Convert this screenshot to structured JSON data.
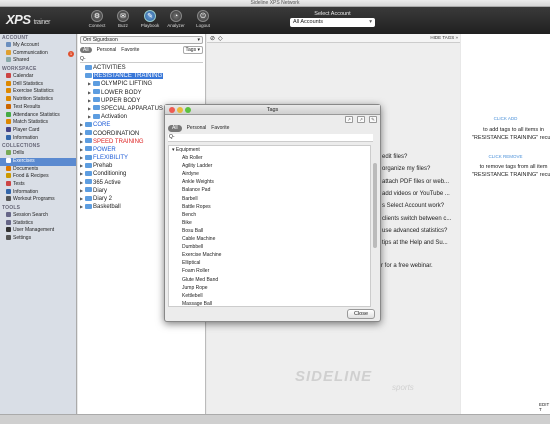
{
  "window": {
    "title": "Sideline XPS Network"
  },
  "toolbar": {
    "logo": "XPS",
    "logo_suffix": "trainer",
    "buttons": [
      {
        "label": "Connect",
        "icon": "connect-icon",
        "glyph": "⚙"
      },
      {
        "label": "Buzz",
        "icon": "buzz-icon",
        "glyph": "✉"
      },
      {
        "label": "Playbook",
        "icon": "playbook-icon",
        "glyph": "✎"
      },
      {
        "label": "Analyzer",
        "icon": "analyzer-icon",
        "glyph": "◔"
      },
      {
        "label": "Logout",
        "icon": "logout-icon",
        "glyph": "⏻"
      }
    ],
    "account_label": "Select Account",
    "account_value": "All Accounts"
  },
  "sidebar": {
    "sections": [
      {
        "title": "ACCOUNT",
        "items": [
          {
            "label": "My Account",
            "color": "#6b8fbf"
          },
          {
            "label": "Communication",
            "color": "#e0a030",
            "badge": "1"
          },
          {
            "label": "Shared",
            "color": "#8aa"
          }
        ]
      },
      {
        "title": "WORKSPACE",
        "items": [
          {
            "label": "Calendar",
            "color": "#c44"
          },
          {
            "label": "Drill Statistics",
            "color": "#d80"
          },
          {
            "label": "Exercise Statistics",
            "color": "#d80"
          },
          {
            "label": "Nutrition Statistics",
            "color": "#d80"
          },
          {
            "label": "Test Results",
            "color": "#c60"
          },
          {
            "label": "Attendance Statistics",
            "color": "#4a4"
          },
          {
            "label": "Match Statistics",
            "color": "#d80"
          },
          {
            "label": "Player Card",
            "color": "#448"
          },
          {
            "label": "Information",
            "color": "#36a"
          }
        ]
      },
      {
        "title": "COLLECTIONS",
        "items": [
          {
            "label": "Drills",
            "color": "#7a5"
          },
          {
            "label": "Exercises",
            "color": "#fff",
            "selected": true
          },
          {
            "label": "Documents",
            "color": "#d70"
          },
          {
            "label": "Food & Recipes",
            "color": "#c90"
          },
          {
            "label": "Tests",
            "color": "#c44"
          },
          {
            "label": "Information",
            "color": "#36a"
          },
          {
            "label": "Workout Programs",
            "color": "#555"
          }
        ]
      },
      {
        "title": "TOOLS",
        "items": [
          {
            "label": "Session Search",
            "color": "#668"
          },
          {
            "label": "Statistics",
            "color": "#668"
          },
          {
            "label": "User Management",
            "color": "#333"
          },
          {
            "label": "Settings",
            "color": "#555"
          }
        ]
      }
    ]
  },
  "middle": {
    "dropdown": "Orri Sigurdsson",
    "tabs": {
      "all": "All",
      "personal": "Personal",
      "favorite": "Favorite",
      "tags": "Tags"
    },
    "search_placeholder": "Q-",
    "tree": [
      {
        "label": "ACTIVITIES",
        "level": 0,
        "arrow": false
      },
      {
        "label": "RESISTANCE TRAINING",
        "level": 0,
        "arrow": false,
        "style": "hl"
      },
      {
        "label": "OLYMPIC LIFTING",
        "level": 1,
        "arrow": true
      },
      {
        "label": "LOWER BODY",
        "level": 1,
        "arrow": true
      },
      {
        "label": "UPPER BODY",
        "level": 1,
        "arrow": true
      },
      {
        "label": "SPECIAL APPARATUS",
        "level": 1,
        "arrow": true
      },
      {
        "label": "Activation",
        "level": 1,
        "arrow": true
      },
      {
        "label": "CORE",
        "level": 0,
        "arrow": true,
        "style": "blue"
      },
      {
        "label": "COORDINATION",
        "level": 0,
        "arrow": true
      },
      {
        "label": "SPEED TRAINING",
        "level": 0,
        "arrow": true,
        "style": "red"
      },
      {
        "label": "POWER",
        "level": 0,
        "arrow": true,
        "style": "blue"
      },
      {
        "label": "FLEXIBILITY",
        "level": 0,
        "arrow": true,
        "style": "blue"
      },
      {
        "label": "Prehab",
        "level": 0,
        "arrow": true
      },
      {
        "label": "Conditioning",
        "level": 0,
        "arrow": true
      },
      {
        "label": "365 Active",
        "level": 0,
        "arrow": true
      },
      {
        "label": "Diary",
        "level": 0,
        "arrow": true
      },
      {
        "label": "Diary 2",
        "level": 0,
        "arrow": true
      },
      {
        "label": "Basketball",
        "level": 0,
        "arrow": true
      }
    ]
  },
  "main": {
    "hide_tags": "HIDE TAGS »",
    "help_lines": [
      "edit files?",
      "organize my files?",
      "attach PDF files or web...",
      "add videos or YouTube ...",
      "s Select Account work?",
      "clients switch between c...",
      "use advanced statistics?",
      "tips at the Help and Su..."
    ],
    "webinar_text": "r for a free webinar.",
    "watermark": "SIDELINE",
    "watermark2": "sports"
  },
  "right": {
    "click_add": "CLICK ADD",
    "add_line1": "to add tags to all items in",
    "add_line2": "\"RESISTANCE TRAINING\" recurs",
    "click_remove": "CLICK REMOVE",
    "remove_line1": "to remove tags from all item",
    "remove_line2": "\"RESISTANCE TRAINING\" recurs",
    "edit": "EDIT T"
  },
  "dialog": {
    "title": "Tags",
    "tabs": {
      "all": "All",
      "personal": "Personal",
      "favorite": "Favorite"
    },
    "search_placeholder": "Q-",
    "parent": "Equipment",
    "items": [
      "Ab Roller",
      "Agility Ladder",
      "Airdyne",
      "Ankle Weights",
      "Balance Pad",
      "Barbell",
      "Battle Ropes",
      "Bench",
      "Bike",
      "Bosu Ball",
      "Cable Machine",
      "Dumbbell",
      "Exercise Machine",
      "Elliptical",
      "Foam Roller",
      "Glute Med Band",
      "Jump Rope",
      "Kettlebell",
      "Massage Ball",
      "Medicine Ball"
    ],
    "close": "Close"
  }
}
